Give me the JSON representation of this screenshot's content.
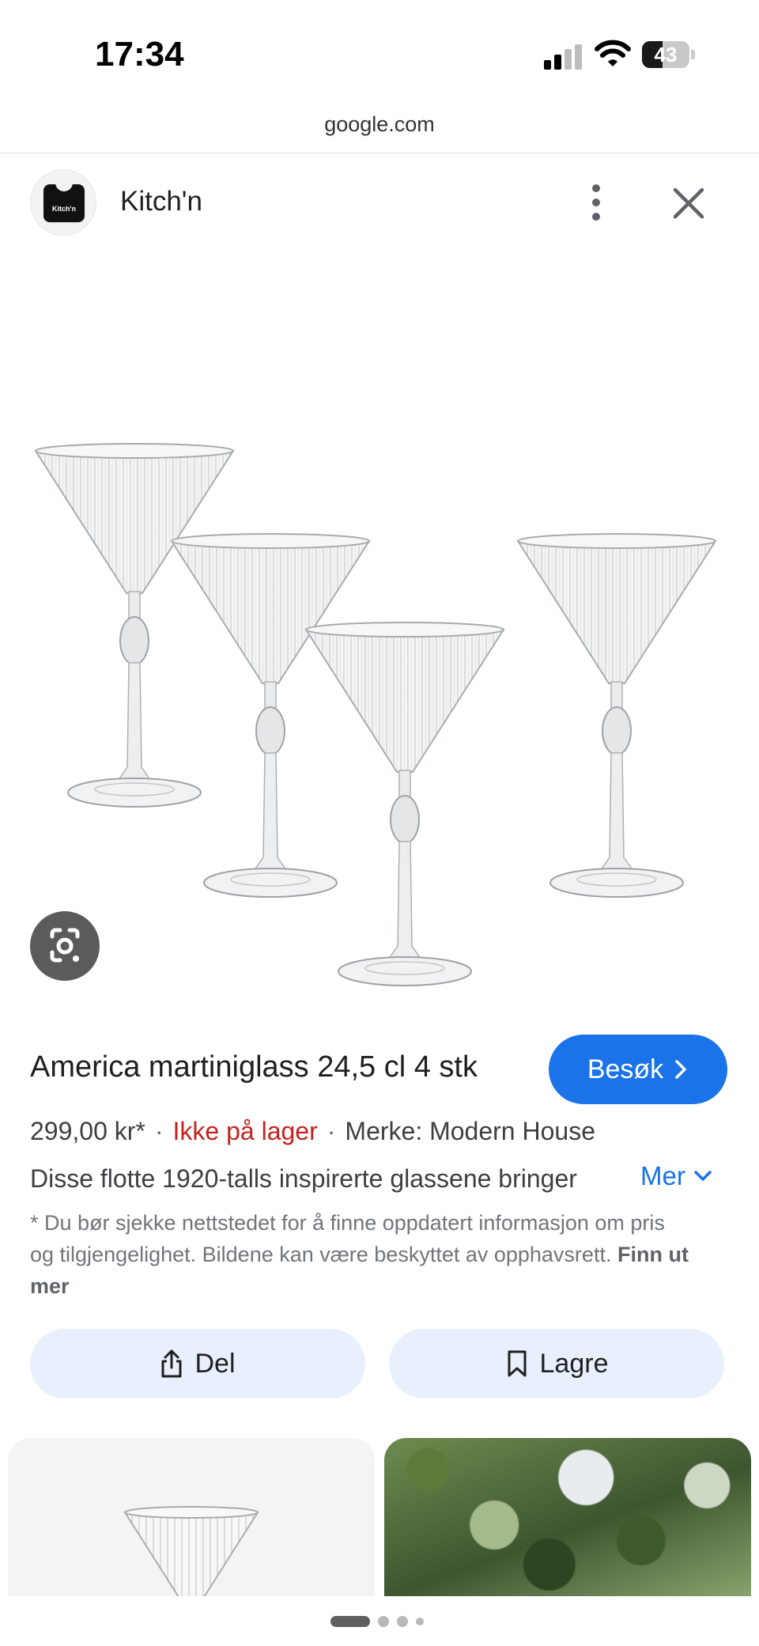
{
  "status_bar": {
    "time": "17:34",
    "battery": "43",
    "battery_level": 0.43
  },
  "browser": {
    "url": "google.com"
  },
  "header": {
    "source_name": "Kitch'n",
    "logo_text": "Kitch'n"
  },
  "product": {
    "title": "America martiniglass 24,5 cl 4 stk",
    "visit_label": "Besøk",
    "price": "299,00 kr*",
    "stock": "Ikke på lager",
    "separator": "·",
    "brand": "Merke: Modern House",
    "description": "Disse flotte 1920-talls inspirerte glassene bringer",
    "more_label": "Mer",
    "disclaimer": "* Du bør sjekke nettstedet for å finne oppdatert informasjon om pris og tilgjengelighet. Bildene kan være beskyttet av opphavsrett.",
    "disclaimer_link": "Finn ut mer"
  },
  "actions": {
    "share_label": "Del",
    "save_label": "Lagre"
  },
  "colors": {
    "accent": "#1a73e8",
    "stock": "#c5221f",
    "pill_bg": "#e8f0fe"
  },
  "icons": [
    "more-vertical-icon",
    "close-icon",
    "google-lens-icon",
    "chevron-right-icon",
    "chevron-down-icon",
    "share-icon",
    "bookmark-icon"
  ]
}
